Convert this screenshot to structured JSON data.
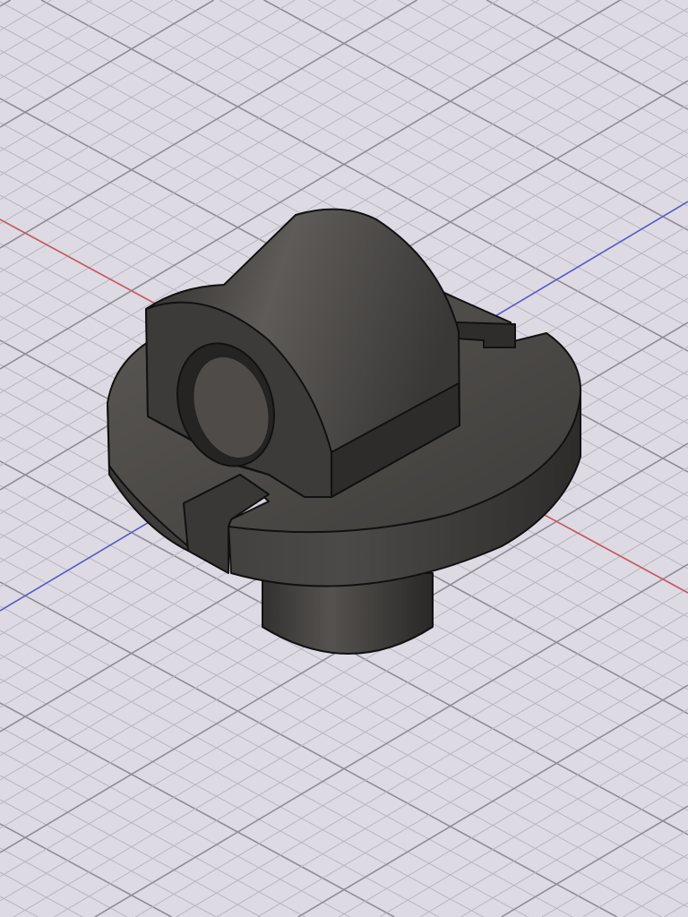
{
  "viewport": {
    "background": "#dddae4",
    "grid_minor_color": "#b9b6c0",
    "grid_major_color": "#8f8c96",
    "x_axis_color": "#d0545a",
    "y_axis_color": "#5a5ad0"
  },
  "model": {
    "body_color": "#4a4846",
    "body_dark": "#2f2d2c",
    "body_light": "#6a6764",
    "edge_color": "#111111"
  }
}
